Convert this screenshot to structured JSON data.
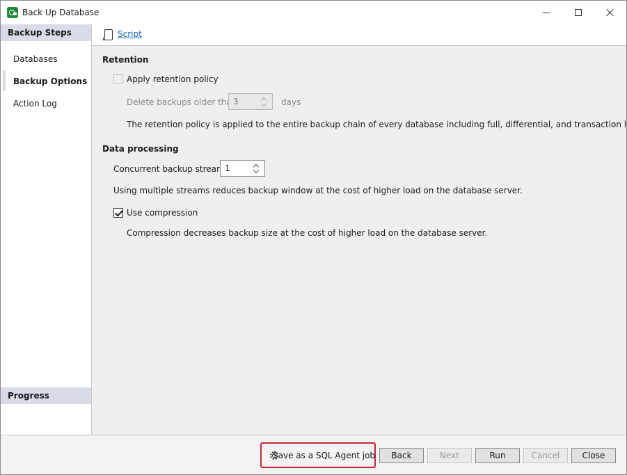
{
  "window": {
    "title": "Back Up Database",
    "icon": "database-backup-icon"
  },
  "nav": {
    "steps_header": "Backup Steps",
    "items": [
      {
        "label": "Databases",
        "active": false
      },
      {
        "label": "Backup Options",
        "active": true
      },
      {
        "label": "Action Log",
        "active": false
      }
    ],
    "progress_header": "Progress"
  },
  "toolbar": {
    "script_label": "Script"
  },
  "retention": {
    "title": "Retention",
    "apply_label": "Apply retention policy",
    "apply_checked": false,
    "delete_label": "Delete backups older than:",
    "delete_value": "3",
    "delete_unit": "days",
    "description": "The retention policy is applied to the entire backup chain of every database including full, differential, and transaction log backups."
  },
  "data_processing": {
    "title": "Data processing",
    "streams_label": "Concurrent backup streams:",
    "streams_value": "1",
    "streams_description": "Using multiple streams reduces backup window at the cost of higher load on the database server.",
    "compression_label": "Use compression",
    "compression_checked": true,
    "compression_description": "Compression decreases backup size at the cost of higher load on the database server."
  },
  "buttons": {
    "agent_job": "Save as a SQL Agent job",
    "back": "Back",
    "next": "Next",
    "run": "Run",
    "cancel": "Cancel",
    "close": "Close"
  },
  "colors": {
    "highlight_border": "#c0263c",
    "link": "#1a63c2",
    "nav_header_bg": "#d9dce8"
  }
}
